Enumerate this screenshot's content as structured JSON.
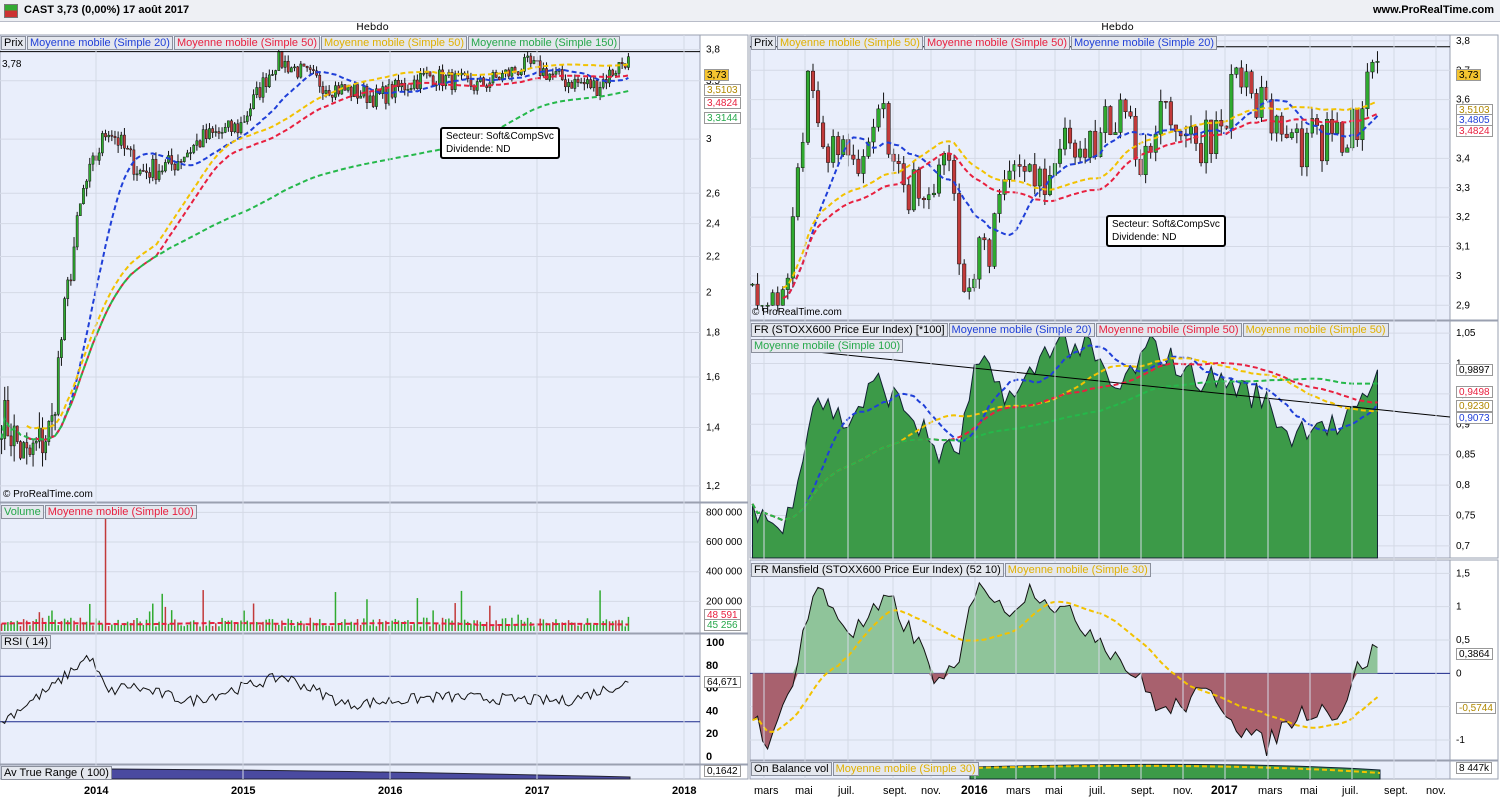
{
  "header": {
    "title": "CAST   3,73 (0,00%)   17 août 2017",
    "site": "www.ProRealTime.com"
  },
  "left": {
    "period": "Hebdo",
    "price_label": "Prix",
    "price_legend": [
      "Moyenne mobile (Simple 20)",
      "Moyenne mobile (Simple 50)",
      "Moyenne mobile (Simple 50)",
      "Moyenne mobile (Simple 150)"
    ],
    "price_ref_label": "3,78",
    "price_tags": [
      "3,73",
      "3,5103",
      "3,4824",
      "3,3144"
    ],
    "annotation": [
      "Secteur: Soft&CompSvc",
      "Dividende: ND"
    ],
    "copyright": "© ProRealTime.com",
    "volume_legend": [
      "Volume",
      "Moyenne mobile (Simple 100)"
    ],
    "volume_tags": [
      "48 591",
      "45 256"
    ],
    "rsi_legend": [
      "RSI ( 14)"
    ],
    "rsi_tag": "64,671",
    "atr_legend": [
      "Av True Range ( 100)"
    ],
    "atr_tag": "0,1642"
  },
  "right": {
    "period": "Hebdo",
    "price_legend": [
      "Prix",
      "Moyenne mobile (Simple 50)",
      "Moyenne mobile (Simple 50)",
      "Moyenne mobile (Simple 20)"
    ],
    "price_tags": [
      "3,73",
      "3,5103",
      "3,4805",
      "3,4824"
    ],
    "annotation": [
      "Secteur: Soft&CompSvc",
      "Dividende: ND"
    ],
    "copyright": "© ProRealTime.com",
    "rs_legend": [
      "FR (STOXX600 Price Eur Index) [*100]",
      "Moyenne mobile (Simple 20)",
      "Moyenne mobile (Simple 50)",
      "Moyenne mobile (Simple 50)",
      "Moyenne mobile (Simple 100)"
    ],
    "rs_tags": [
      "0,9897",
      "0,9498",
      "0,9230",
      "0,9073"
    ],
    "mans_legend": [
      "FR Mansfield (STOXX600 Price Eur Index) (52 10)",
      "Moyenne mobile (Simple 30)"
    ],
    "mans_tags": [
      "0,3864",
      "-0,5744"
    ],
    "obv_legend": [
      "On Balance vol",
      "Moyenne mobile (Simple 30)"
    ],
    "obv_tag": "8 447k"
  },
  "colors": {
    "ma20": "#1f3fd8",
    "ma50": "#e8203f",
    "ma50b": "#f2c200",
    "ma150": "#25b84a",
    "up": "#2faa2f",
    "down": "#c23a3a",
    "rsfill": "#3c9a48",
    "panel": "#e9eefb"
  },
  "chart_data": [
    {
      "type": "candlestick",
      "title": "Hebdo",
      "period": "weekly",
      "x_ticks": [
        "2014",
        "2015",
        "2016",
        "2017",
        "2018"
      ],
      "y_ticks": [
        1.2,
        1.4,
        1.6,
        1.8,
        2,
        2.2,
        2.4,
        2.6,
        3,
        3.5,
        3.8
      ],
      "ylim": [
        1.15,
        3.95
      ],
      "y_scale": "log",
      "anchors": {
        "x": [
          0,
          0.04,
          0.08,
          0.13,
          0.17,
          0.22,
          0.27,
          0.32,
          0.38,
          0.44,
          0.52,
          0.6,
          0.68,
          0.76,
          0.84,
          0.9,
          0.95,
          1
        ],
        "close": [
          1.45,
          1.28,
          1.4,
          2.6,
          3.1,
          2.75,
          2.8,
          3.0,
          3.1,
          3.7,
          3.45,
          3.35,
          3.55,
          3.45,
          3.65,
          3.5,
          3.45,
          3.73
        ]
      },
      "last": 3.73,
      "ref_level": 3.78,
      "series": [
        {
          "name": "Moyenne mobile (Simple 20)",
          "values_at_end": 3.4824
        },
        {
          "name": "Moyenne mobile (Simple 50)",
          "values_at_end": 3.5103
        },
        {
          "name": "Moyenne mobile (Simple 150)",
          "values_at_end": 3.3144
        }
      ]
    },
    {
      "type": "bar",
      "title": "Volume",
      "y_ticks": [
        200000,
        400000,
        600000,
        800000
      ],
      "ylim": [
        0,
        850000
      ],
      "peak": 760000,
      "series": [
        {
          "name": "Moyenne mobile (Simple 100)",
          "values_at_end": 48591
        }
      ],
      "last": 45256
    },
    {
      "type": "line",
      "title": "RSI ( 14)",
      "y_ticks": [
        0,
        20,
        40,
        60,
        80,
        100
      ],
      "ylim": [
        0,
        100
      ],
      "levels": [
        30,
        70
      ],
      "anchors": {
        "x": [
          0,
          0.03,
          0.08,
          0.14,
          0.17,
          0.2,
          0.3,
          0.45,
          0.55,
          0.7,
          0.8,
          0.9,
          1
        ],
        "y": [
          30,
          42,
          60,
          88,
          55,
          62,
          48,
          70,
          45,
          52,
          50,
          48,
          64.671
        ]
      },
      "last": 64.671
    },
    {
      "type": "area",
      "title": "Av True Range ( 100)",
      "last": 0.1642
    },
    {
      "type": "candlestick",
      "title": "Hebdo",
      "period": "weekly",
      "x_ticks": [
        "mars",
        "mai",
        "juil.",
        "sept.",
        "nov.",
        "2016",
        "mars",
        "mai",
        "juil.",
        "sept.",
        "nov.",
        "2017",
        "mars",
        "mai",
        "juil.",
        "sept.",
        "nov."
      ],
      "y_ticks": [
        2.9,
        3,
        3.1,
        3.2,
        3.3,
        3.4,
        3.5,
        3.6,
        3.7,
        3.8
      ],
      "ylim": [
        2.85,
        3.82
      ],
      "anchors": {
        "x": [
          0,
          0.03,
          0.06,
          0.09,
          0.12,
          0.16,
          0.2,
          0.24,
          0.28,
          0.31,
          0.34,
          0.38,
          0.42,
          0.46,
          0.5,
          0.54,
          0.58,
          0.62,
          0.66,
          0.7,
          0.74,
          0.78,
          0.82,
          0.86,
          0.9,
          0.94,
          0.97,
          1
        ],
        "close": [
          2.95,
          2.9,
          3.1,
          3.7,
          3.45,
          3.35,
          3.6,
          3.3,
          3.3,
          3.4,
          3.0,
          3.1,
          3.35,
          3.3,
          3.5,
          3.45,
          3.55,
          3.4,
          3.6,
          3.45,
          3.5,
          3.7,
          3.55,
          3.45,
          3.45,
          3.45,
          3.5,
          3.73
        ]
      },
      "last": 3.73,
      "ref_level": 3.78
    },
    {
      "type": "area",
      "title": "FR (STOXX600 Price Eur Index) [*100]",
      "y_ticks": [
        0.7,
        0.75,
        0.8,
        0.85,
        0.9,
        0.95,
        1,
        1.05
      ],
      "ylim": [
        0.68,
        1.07
      ],
      "anchors": {
        "x": [
          0,
          0.05,
          0.1,
          0.15,
          0.2,
          0.25,
          0.3,
          0.33,
          0.36,
          0.42,
          0.48,
          0.54,
          0.58,
          0.64,
          0.7,
          0.76,
          0.82,
          0.86,
          0.9,
          0.94,
          0.97,
          1
        ],
        "y": [
          0.77,
          0.72,
          0.95,
          0.9,
          0.97,
          0.92,
          0.85,
          0.86,
          1.0,
          0.94,
          1.04,
          1.02,
          0.95,
          1.03,
          0.98,
          0.97,
          0.94,
          0.88,
          0.91,
          0.89,
          0.92,
          0.9897
        ]
      },
      "last": 0.9897,
      "series": [
        {
          "name": "Moyenne mobile (Simple 20)",
          "values_at_end": 0.9073
        },
        {
          "name": "Moyenne mobile (Simple 50)",
          "values_at_end": 0.9498
        },
        {
          "name": "Moyenne mobile (Simple 100)",
          "values_at_end": 0.923
        }
      ]
    },
    {
      "type": "area",
      "title": "FR Mansfield (STOXX600 Price Eur Index) (52 10)",
      "y_ticks": [
        -1,
        -0.5,
        0,
        0.5,
        1,
        1.5
      ],
      "ylim": [
        -1.3,
        1.7
      ],
      "anchors": {
        "x": [
          0,
          0.03,
          0.06,
          0.1,
          0.16,
          0.22,
          0.28,
          0.3,
          0.33,
          0.36,
          0.4,
          0.45,
          0.5,
          0.55,
          0.6,
          0.66,
          0.7,
          0.74,
          0.78,
          0.82,
          0.86,
          0.9,
          0.94,
          0.97,
          1
        ],
        "y": [
          -0.6,
          -1.1,
          -0.2,
          1.3,
          0.6,
          1.1,
          0.2,
          -0.2,
          0.1,
          1.5,
          0.9,
          1.3,
          0.9,
          0.6,
          0.1,
          -0.6,
          -0.4,
          -0.3,
          -0.8,
          -1.1,
          -0.7,
          -0.5,
          -0.6,
          0.1,
          0.3864
        ]
      },
      "last": 0.3864,
      "series": [
        {
          "name": "Moyenne mobile (Simple 30)",
          "values_at_end": -0.5744
        }
      ]
    },
    {
      "type": "area",
      "title": "On Balance vol",
      "series": [
        {
          "name": "Moyenne mobile (Simple 30)"
        }
      ],
      "last": "8 447k"
    }
  ]
}
